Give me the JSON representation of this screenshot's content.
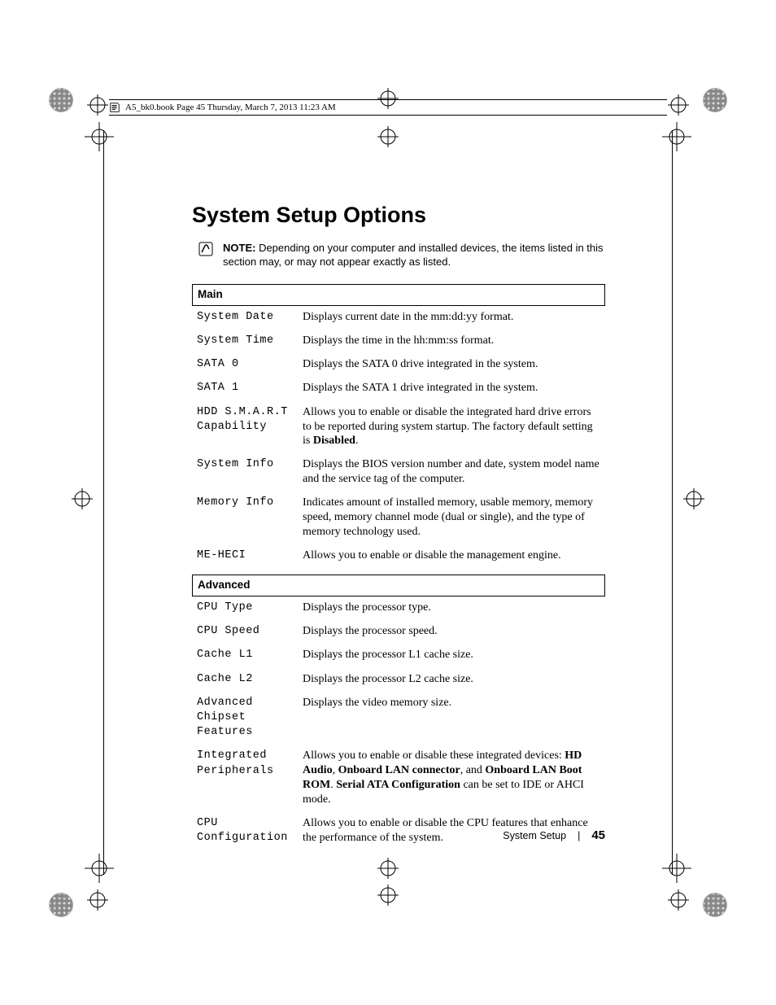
{
  "header": {
    "text": "A5_bk0.book  Page 45  Thursday, March 7, 2013  11:23 AM"
  },
  "title": "System Setup Options",
  "note": {
    "label": "NOTE:",
    "text": " Depending on your computer and installed devices, the items listed in this section may, or may not appear exactly as listed."
  },
  "sections": [
    {
      "name": "Main",
      "rows": [
        {
          "k": "System Date",
          "v": "Displays current date in the mm:dd:yy format."
        },
        {
          "k": "System Time",
          "v": "Displays the time in the hh:mm:ss format."
        },
        {
          "k": "SATA 0",
          "v": "Displays the SATA 0 drive integrated in the system."
        },
        {
          "k": "SATA 1",
          "v": "Displays the SATA 1 drive integrated in the system."
        },
        {
          "k": "HDD S.M.A.R.T Capability",
          "v": "Allows you to enable or disable the integrated hard drive errors to be reported during system startup. The factory default setting is <b>Disabled</b>."
        },
        {
          "k": "System Info",
          "v": "Displays the BIOS version number and date, system model name and the service tag of the computer."
        },
        {
          "k": "Memory Info",
          "v": "Indicates amount of installed memory, usable memory, memory speed, memory channel mode (dual or single), and the type of memory technology used."
        },
        {
          "k": "ME-HECI",
          "v": "Allows you to enable or disable the management engine."
        }
      ]
    },
    {
      "name": "Advanced",
      "rows": [
        {
          "k": "CPU Type",
          "v": "Displays the processor type."
        },
        {
          "k": "CPU Speed",
          "v": "Displays the processor speed."
        },
        {
          "k": "Cache L1",
          "v": "Displays the processor L1 cache size."
        },
        {
          "k": "Cache L2",
          "v": "Displays the processor L2 cache size."
        },
        {
          "k": "Advanced Chipset Features",
          "v": "Displays the video memory size."
        },
        {
          "k": "Integrated Peripherals",
          "v": "Allows you to enable or disable these integrated devices: <b>HD Audio</b>, <b>Onboard LAN connector</b>, and <b>Onboard LAN Boot ROM</b>. <b>Serial ATA Configuration</b> can be set to IDE or AHCI mode."
        },
        {
          "k": "CPU Configuration",
          "v": "Allows you to enable or disable the CPU features that enhance the performance of the system."
        }
      ]
    }
  ],
  "footer": {
    "section": "System Setup",
    "page": "45"
  }
}
